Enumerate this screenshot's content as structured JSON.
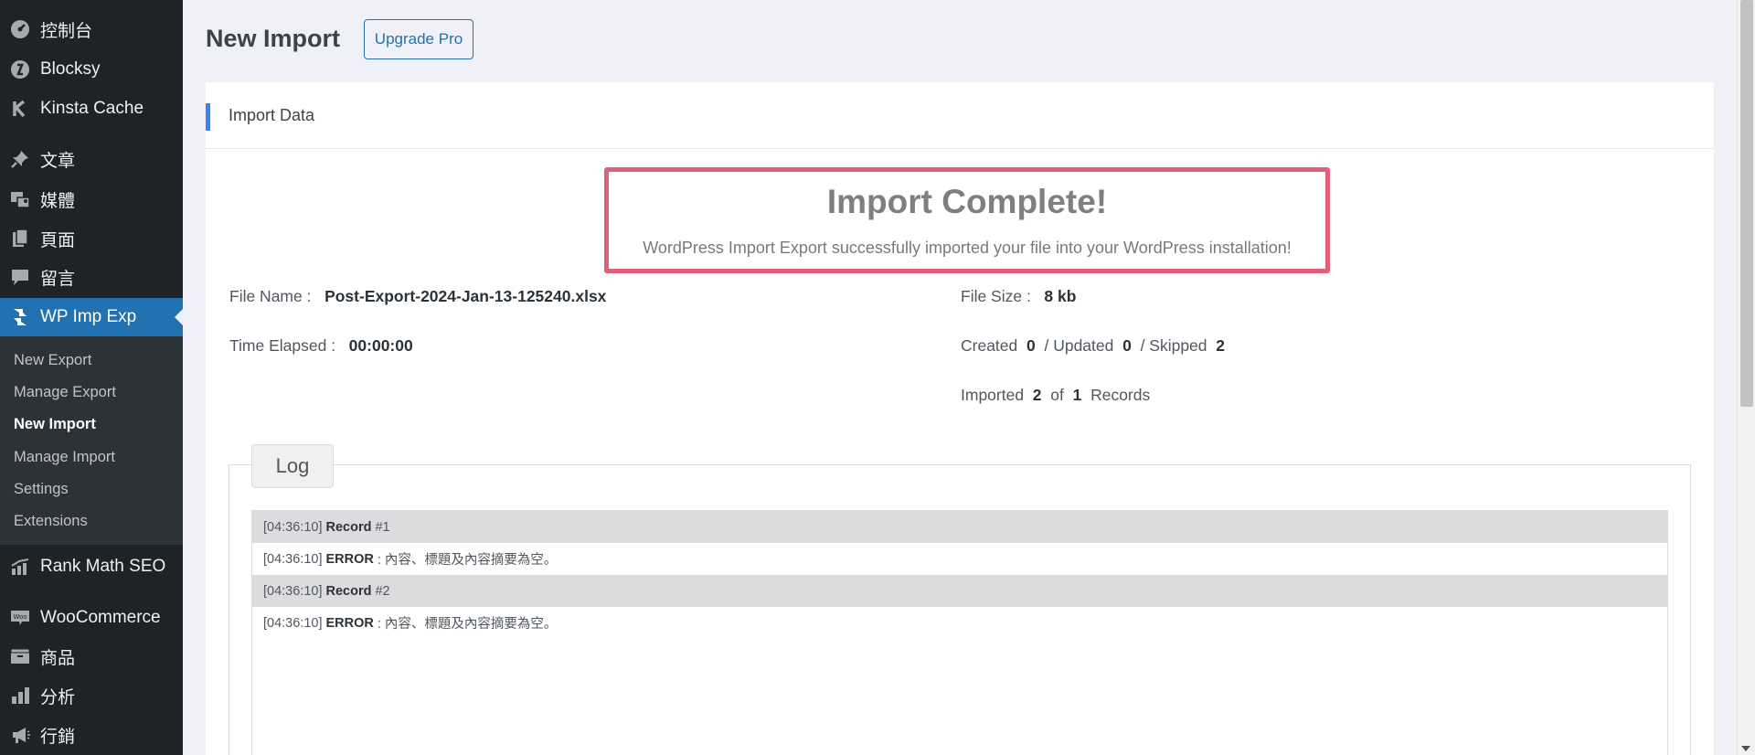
{
  "sidebar": {
    "items": [
      {
        "label": "控制台",
        "icon": "dashboard-icon"
      },
      {
        "label": "Blocksy",
        "icon": "blocksy-icon"
      },
      {
        "label": "Kinsta Cache",
        "icon": "kinsta-icon"
      },
      {
        "label": "文章",
        "icon": "pin-icon"
      },
      {
        "label": "媒體",
        "icon": "media-icon"
      },
      {
        "label": "頁面",
        "icon": "page-icon"
      },
      {
        "label": "留言",
        "icon": "comment-icon"
      },
      {
        "label": "WP Imp Exp",
        "icon": "imp-exp-icon"
      },
      {
        "label": "Rank Math SEO",
        "icon": "rank-math-icon"
      },
      {
        "label": "WooCommerce",
        "icon": "woocommerce-icon"
      },
      {
        "label": "商品",
        "icon": "products-icon"
      },
      {
        "label": "分析",
        "icon": "analytics-icon"
      },
      {
        "label": "行銷",
        "icon": "megaphone-icon"
      }
    ],
    "submenu": [
      "New Export",
      "Manage Export",
      "New Import",
      "Manage Import",
      "Settings",
      "Extensions"
    ]
  },
  "header": {
    "title": "New Import",
    "upgrade_label": "Upgrade Pro"
  },
  "card": {
    "title": "Import Data",
    "complete_heading": "Import Complete!",
    "complete_message": "WordPress Import Export successfully imported your file into your WordPress installation!",
    "file_name_label": "File Name :",
    "file_name": "Post-Export-2024-Jan-13-125240.xlsx",
    "file_size_label": "File Size :",
    "file_size": "8 kb",
    "time_elapsed_label": "Time Elapsed :",
    "time_elapsed": "00:00:00",
    "created_label": "Created",
    "created": "0",
    "updated_label": "/ Updated",
    "updated": "0",
    "skipped_label": "/ Skipped",
    "skipped": "2",
    "imported_label": "Imported",
    "imported": "2",
    "of_label": "of",
    "total": "1",
    "records_label": "Records"
  },
  "log": {
    "legend": "Log",
    "rows": [
      {
        "time": "[04:36:10]",
        "kind": "Record",
        "text": "#1"
      },
      {
        "time": "[04:36:10]",
        "kind": "ERROR",
        "text": ": 內容、標題及內容摘要為空。"
      },
      {
        "time": "[04:36:10]",
        "kind": "Record",
        "text": "#2"
      },
      {
        "time": "[04:36:10]",
        "kind": "ERROR",
        "text": ": 內容、標題及內容摘要為空。"
      }
    ]
  },
  "colors": {
    "sidebar_bg": "#1d2327",
    "active": "#2271b1",
    "highlight_border": "#e0607a",
    "accent_bar": "#3b82f6"
  }
}
